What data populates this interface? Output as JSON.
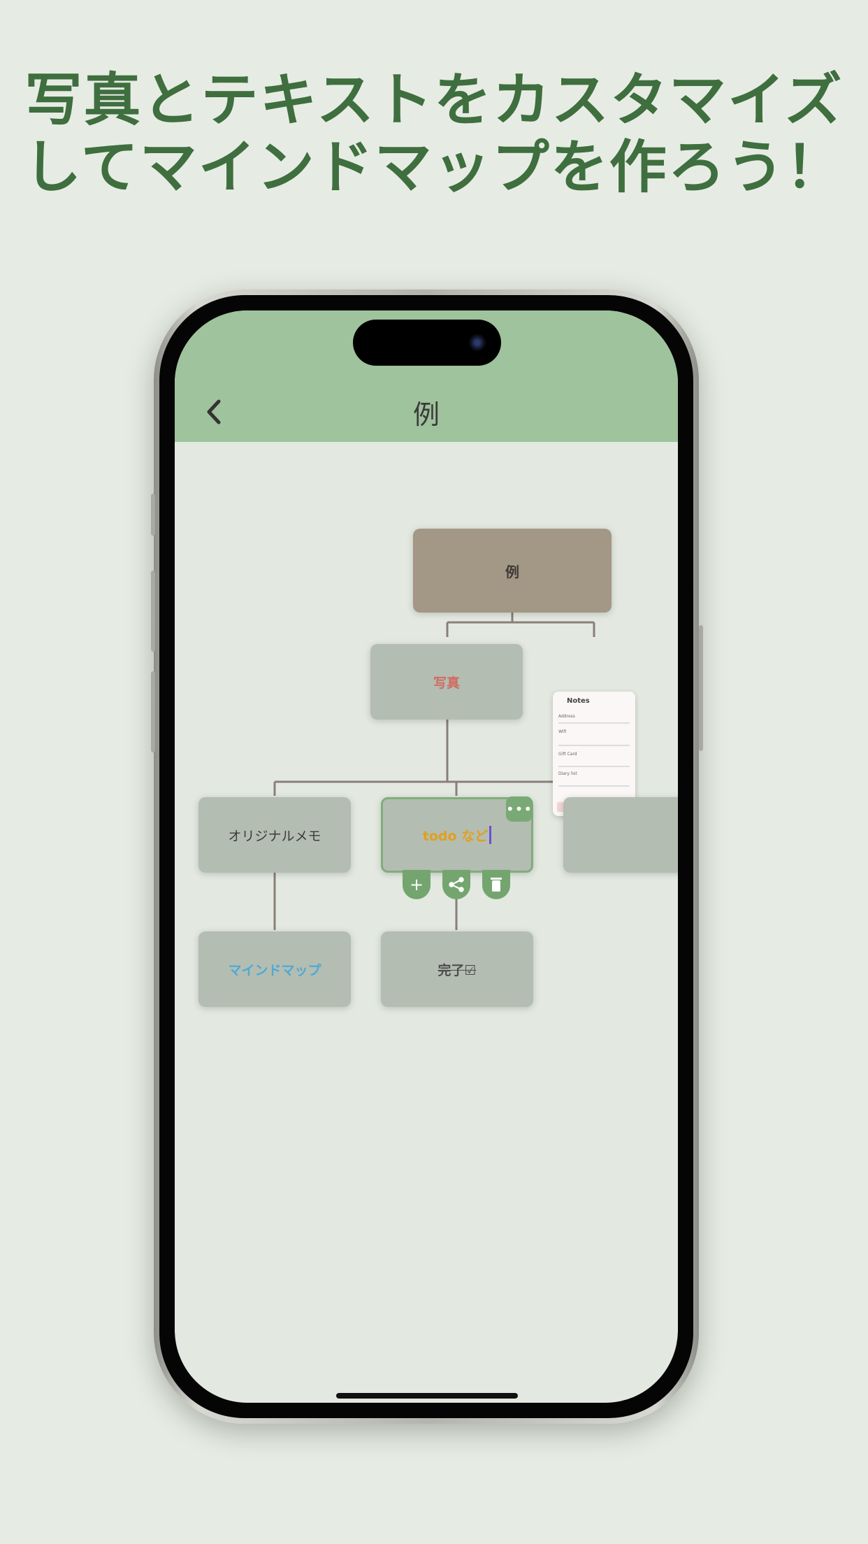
{
  "headline": {
    "line1": "写真とテキストをカスタマイズ",
    "line2": "してマインドマップを作ろう！"
  },
  "navbar": {
    "back_icon": "chevron-left-icon",
    "back_glyph": "‹",
    "title": "例"
  },
  "mindmap": {
    "root": "例",
    "photo": "写真",
    "memo": "オリジナルメモ",
    "todo": "todo など",
    "blank": "",
    "mindmap": "マインドマップ",
    "done": "完了☑"
  },
  "thumbnail": {
    "app_title": "Notes",
    "field": "Address",
    "item1": "Wifi",
    "item2": "Gift Card",
    "item3": "Diary list"
  },
  "actions": {
    "more": "•••",
    "add": "+",
    "branch_icon": "branch-icon",
    "delete_icon": "trash-icon"
  },
  "colors": {
    "headline": "#3f6e3f",
    "navbar": "#9fc39d",
    "node": "#b4bdb1",
    "root_node": "#a39785",
    "accent_button": "#74a56f",
    "photo_text": "#d06b62",
    "todo_text": "#e0a01e",
    "mindmap_text": "#4da9d8"
  }
}
